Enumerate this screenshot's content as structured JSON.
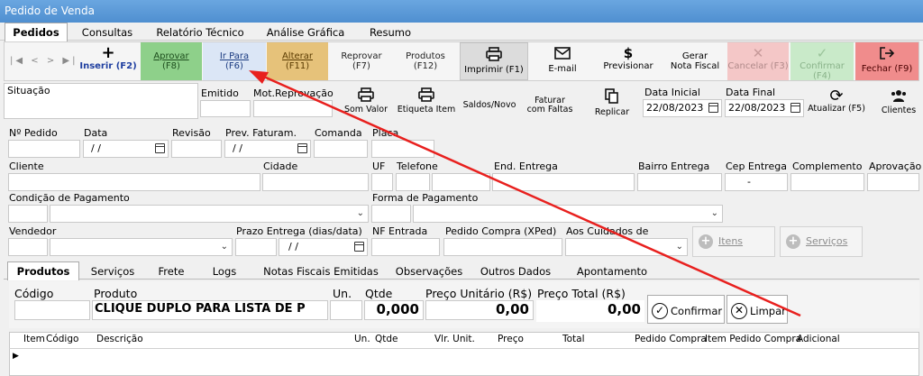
{
  "window": {
    "title": "Pedido de Venda"
  },
  "main_tabs": [
    {
      "label": "Pedidos"
    },
    {
      "label": "Consultas"
    },
    {
      "label": "Relatório Técnico"
    },
    {
      "label": "Análise Gráfica"
    },
    {
      "label": "Resumo"
    }
  ],
  "nav": {
    "first": "|◀",
    "prev": "<",
    "next": ">",
    "last": "▶|"
  },
  "toolbar": [
    {
      "l1": "Inserir (F2)",
      "icon": "+"
    },
    {
      "l1": "Aprovar",
      "l2": "(F8)"
    },
    {
      "l1": "Ir Para",
      "l2": "(F6)"
    },
    {
      "l1": "Alterar",
      "l2": "(F11)"
    },
    {
      "l1": "Reprovar",
      "l2": "(F7)"
    },
    {
      "l1": "Produtos",
      "l2": "(F12)"
    },
    {
      "l1": "Imprimir (F1)"
    },
    {
      "l1": "E-mail"
    },
    {
      "l1": "Previsionar",
      "icon": "$"
    },
    {
      "l1": "Gerar",
      "l2": "Nota Fiscal"
    },
    {
      "l1": "Cancelar (F3)"
    },
    {
      "l1": "Confirmar (F4)"
    },
    {
      "l1": "Fechar (F9)"
    }
  ],
  "row2": {
    "situacao": "Situação",
    "emitido": "Emitido",
    "mot_reprovacao": "Mot.Reprovação",
    "som_valor": "Som Valor",
    "etiqueta_item": "Etiqueta Item",
    "saldos_novo": "Saldos/Novo",
    "faturar_l1": "Faturar",
    "faturar_l2": "com Faltas",
    "replicar": "Replicar",
    "data_inicial_label": "Data Inicial",
    "data_inicial_value": "22/08/2023",
    "data_final_label": "Data Final",
    "data_final_value": "22/08/2023",
    "atualizar": "Atualizar (F5)",
    "clientes": "Clientes"
  },
  "form": {
    "nr_pedido": "Nº Pedido",
    "data": "Data",
    "data_value": "/ /",
    "revisao": "Revisão",
    "prev_faturam": "Prev. Faturam.",
    "prev_value": "/ /",
    "comanda": "Comanda",
    "placa": "Placa",
    "cliente": "Cliente",
    "cidade": "Cidade",
    "uf": "UF",
    "telefone": "Telefone",
    "end_entrega": "End. Entrega",
    "bairro_entrega": "Bairro Entrega",
    "cep_entrega": "Cep Entrega",
    "cep_value": "-",
    "complemento": "Complemento",
    "aprovacao": "Aprovação",
    "cond_pagamento": "Condição de Pagamento",
    "forma_pagamento": "Forma de Pagamento",
    "vendedor": "Vendedor",
    "prazo_entrega": "Prazo Entrega (dias/data)",
    "prazo_value": "/ /",
    "nf_entrada": "NF Entrada",
    "pedido_compra": "Pedido Compra (XPed)",
    "aos_cuidados": "Aos Cuidados de",
    "itens_btn": "Itens",
    "servicos_btn": "Serviços"
  },
  "sub_tabs": [
    {
      "label": "Produtos"
    },
    {
      "label": "Serviços"
    },
    {
      "label": "Frete"
    },
    {
      "label": "Logs"
    },
    {
      "label": "Notas Fiscais Emitidas"
    },
    {
      "label": "Observações"
    },
    {
      "label": "Outros Dados"
    },
    {
      "label": "Apontamento"
    }
  ],
  "entry": {
    "codigo": "Código",
    "produto": "Produto",
    "produto_value": "CLIQUE DUPLO PARA LISTA DE P",
    "un": "Un.",
    "qtde": "Qtde",
    "qtde_value": "0,000",
    "preco_unit": "Preço Unitário (R$)",
    "preco_unit_value": "0,00",
    "preco_total": "Preço Total (R$)",
    "preco_total_value": "0,00",
    "confirmar": "Confirmar",
    "limpar": "Limpar"
  },
  "grid_columns": [
    "Item",
    "Código",
    "Descrição",
    "Un.",
    "Qtde",
    "Vlr. Unit.",
    "Preço",
    "Total",
    "Pedido Compra",
    "Item Pedido Compra",
    "Adicional"
  ],
  "colors": {
    "title_bar": "#5b9bd5",
    "aprovar": "#8ed08a",
    "alterar": "#e6c27a",
    "ir_para": "#dbe6f6",
    "cancelar": "#f4c7c7",
    "confirmar": "#c9eac9",
    "fechar": "#f08c8c",
    "arrow": "#e8201e"
  }
}
